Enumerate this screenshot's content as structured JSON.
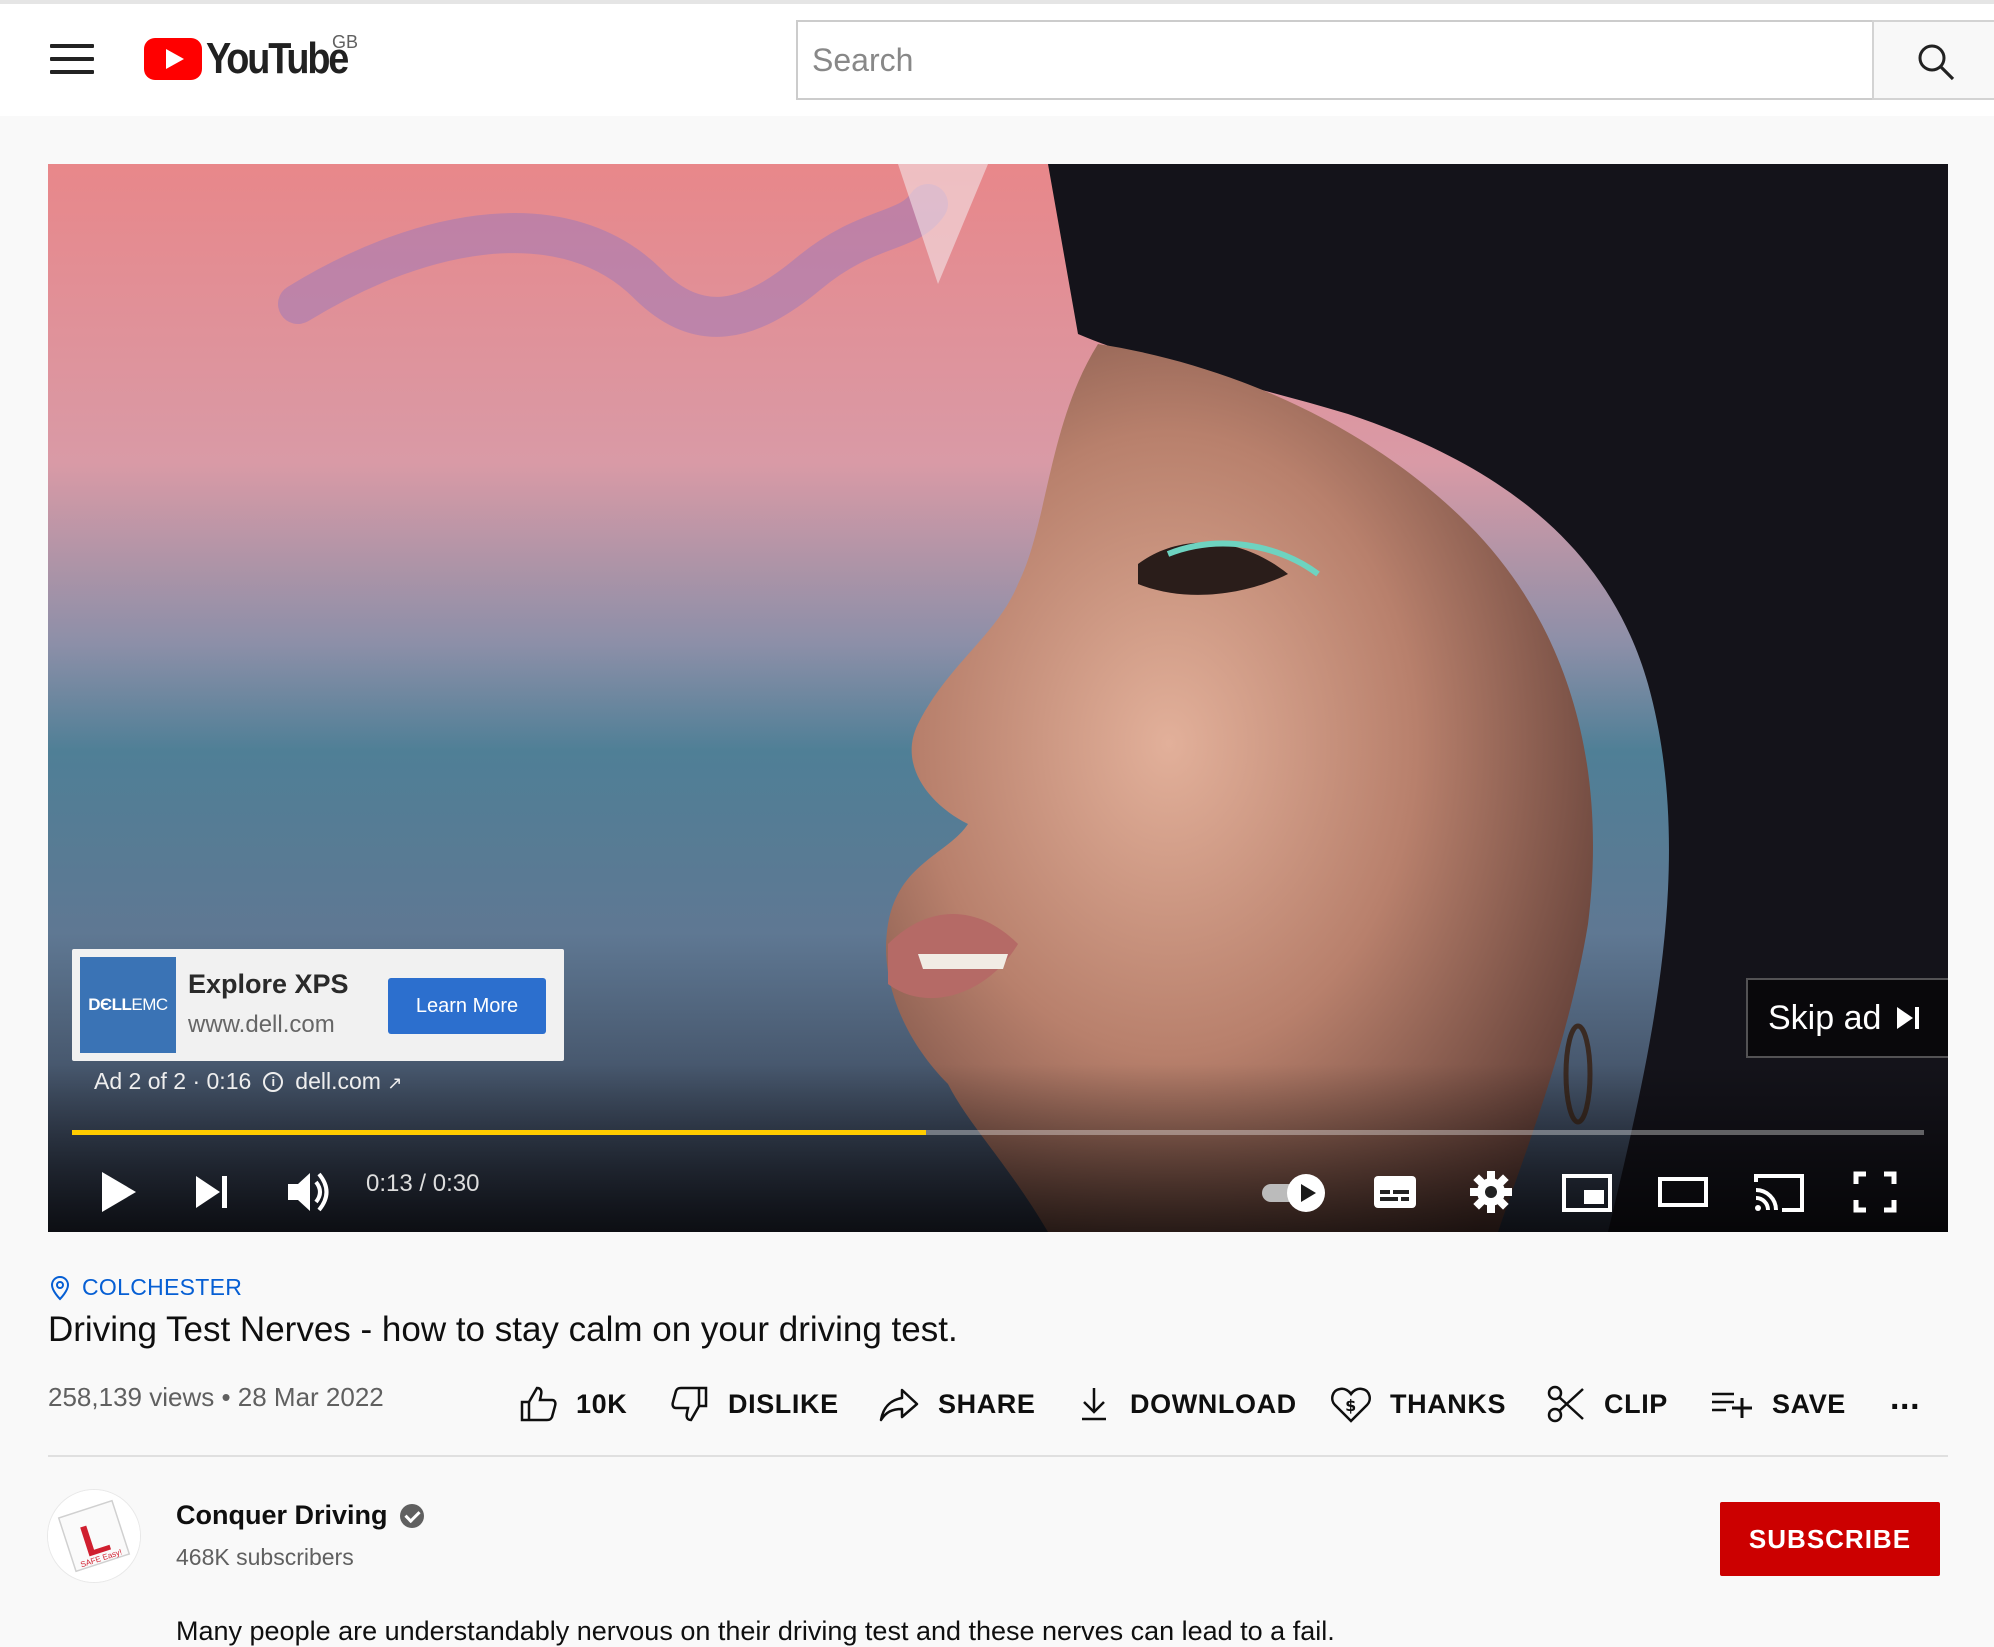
{
  "masthead": {
    "logo_text": "YouTube",
    "country_code": "GB",
    "search_placeholder": "Search"
  },
  "player": {
    "ad": {
      "brand_logo_text_bold": "DЄLL",
      "brand_logo_text_light": "EMC",
      "title": "Explore XPS",
      "url": "www.dell.com",
      "cta_label": "Learn More",
      "ad_position": "Ad 2 of 2 · 0:16",
      "ad_domain": "dell.com"
    },
    "skip_label": "Skip ad",
    "time_display": "0:13 / 0:30",
    "progress_fraction": 0.461
  },
  "video": {
    "location": "COLCHESTER",
    "title": "Driving Test Nerves - how to stay calm on your driving test.",
    "views_and_date": "258,139 views • 28 Mar 2022"
  },
  "actions": {
    "like": "10K",
    "dislike": "DISLIKE",
    "share": "SHARE",
    "download": "DOWNLOAD",
    "thanks": "THANKS",
    "clip": "CLIP",
    "save": "SAVE",
    "more": "..."
  },
  "channel": {
    "name": "Conquer Driving",
    "subscribers": "468K subscribers",
    "subscribe_label": "SUBSCRIBE",
    "avatar_text": "SAFE Easy!",
    "avatar_letter": "L"
  },
  "description": {
    "first_line": "Many people are understandably nervous on their driving test and these nerves can lead to a fail."
  },
  "colors": {
    "progress": "#ffcc00",
    "subscribe": "#cc0000",
    "link_blue": "#065fd4",
    "ad_button": "#2c6fce",
    "dell_blue": "#3a73b5"
  }
}
